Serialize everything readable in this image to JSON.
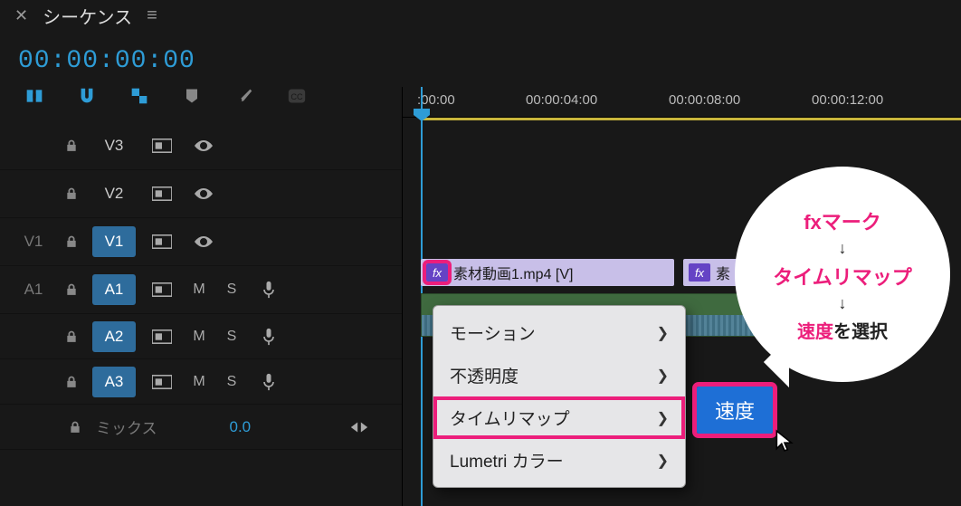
{
  "header": {
    "title": "シーケンス"
  },
  "timecode": "00:00:00:00",
  "ruler": {
    "t0": ":00:00",
    "t1": "00:00:04:00",
    "t2": "00:00:08:00",
    "t3": "00:00:12:00"
  },
  "tracks": {
    "outer_v1": "V1",
    "outer_a1": "A1",
    "v3": "V3",
    "v2": "V2",
    "v1": "V1",
    "a1": "A1",
    "a2": "A2",
    "a3": "A3",
    "m": "M",
    "s": "S",
    "mix_label": "ミックス",
    "mix_val": "0.0"
  },
  "clip": {
    "fx": "fx",
    "name": "素材動画1.mp4 [V]",
    "name2": "素"
  },
  "menu": {
    "motion": "モーション",
    "opacity": "不透明度",
    "timeremap": "タイムリマップ",
    "lumetri": "Lumetri カラー"
  },
  "submenu": {
    "speed": "速度"
  },
  "bubble": {
    "l1": "fxマーク",
    "l2": "タイムリマップ",
    "l3a": "速度",
    "l3b": "を選択"
  }
}
